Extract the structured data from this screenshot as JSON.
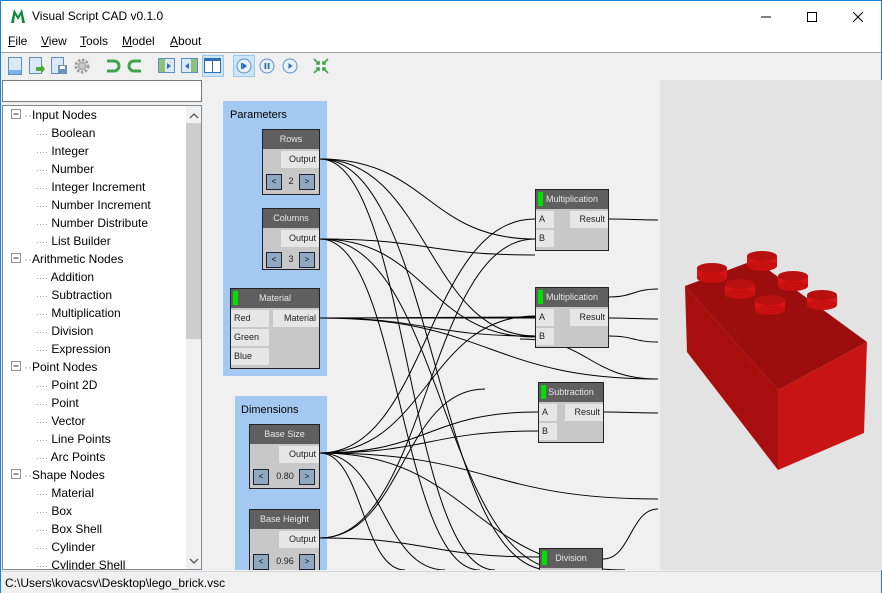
{
  "window": {
    "title": "Visual Script CAD v0.1.0",
    "controls": [
      "minimize",
      "maximize",
      "close"
    ]
  },
  "menu": {
    "items": [
      {
        "label": "File",
        "accel": "F",
        "rest": "ile"
      },
      {
        "label": "View",
        "accel": "V",
        "rest": "iew"
      },
      {
        "label": "Tools",
        "accel": "T",
        "rest": "ools"
      },
      {
        "label": "Model",
        "accel": "M",
        "rest": "odel"
      },
      {
        "label": "About",
        "accel": "A",
        "rest": "bout"
      }
    ]
  },
  "toolbar": {
    "buttons": [
      {
        "icon": "new-file-icon",
        "active": false
      },
      {
        "icon": "open-file-icon",
        "active": false
      },
      {
        "icon": "save-file-icon",
        "active": false
      },
      {
        "icon": "settings-gear-icon",
        "active": false
      },
      {
        "icon": "undo-icon",
        "active": false
      },
      {
        "icon": "redo-icon",
        "active": false
      },
      {
        "icon": "show-left-panel-icon",
        "active": false
      },
      {
        "icon": "show-right-panel-icon",
        "active": false
      },
      {
        "icon": "split-view-icon",
        "active": true
      },
      {
        "icon": "manual-update-icon",
        "active": true
      },
      {
        "icon": "pause-update-icon",
        "active": false
      },
      {
        "icon": "auto-update-icon",
        "active": false
      },
      {
        "icon": "fit-to-view-icon",
        "active": false
      }
    ]
  },
  "search": {
    "value": "",
    "placeholder": ""
  },
  "tree": {
    "categories": [
      {
        "label": "Input Nodes",
        "expanded": true,
        "items": [
          "Boolean",
          "Integer",
          "Number",
          "Integer Increment",
          "Number Increment",
          "Number Distribute",
          "List Builder"
        ]
      },
      {
        "label": "Arithmetic Nodes",
        "expanded": true,
        "items": [
          "Addition",
          "Subtraction",
          "Multiplication",
          "Division",
          "Expression"
        ]
      },
      {
        "label": "Point Nodes",
        "expanded": true,
        "items": [
          "Point 2D",
          "Point",
          "Vector",
          "Line Points",
          "Arc Points"
        ]
      },
      {
        "label": "Shape Nodes",
        "expanded": true,
        "items": [
          "Material",
          "Box",
          "Box Shell",
          "Cylinder",
          "Cylinder Shell"
        ]
      }
    ]
  },
  "graph": {
    "groups": [
      {
        "title": "Parameters"
      },
      {
        "title": "Dimensions"
      }
    ],
    "nodes": {
      "rows": {
        "title": "Rows",
        "output": "Output",
        "value": "2",
        "prev": "<",
        "next": ">"
      },
      "columns": {
        "title": "Columns",
        "output": "Output",
        "value": "3",
        "prev": "<",
        "next": ">"
      },
      "material": {
        "title": "Material",
        "inputs": [
          "Red",
          "Green",
          "Blue"
        ],
        "output": "Material"
      },
      "base_size": {
        "title": "Base Size",
        "output": "Output",
        "value": "0.80",
        "prev": "<",
        "next": ">"
      },
      "base_height": {
        "title": "Base Height",
        "output": "Output",
        "value": "0.96",
        "prev": "<",
        "next": ">"
      },
      "mult1": {
        "title": "Multiplication",
        "inputs": [
          "A",
          "B"
        ],
        "output": "Result"
      },
      "mult2": {
        "title": "Multiplication",
        "inputs": [
          "A",
          "B"
        ],
        "output": "Result"
      },
      "subtraction": {
        "title": "Subtraction",
        "inputs": [
          "A",
          "B"
        ],
        "output": "Result"
      },
      "division": {
        "title": "Division"
      }
    },
    "accent_color": "#00e000"
  },
  "viewport": {
    "model": "lego-brick-2x3",
    "model_color": "#cc1111"
  },
  "status": {
    "path": "C:\\Users\\kovacsv\\Desktop\\lego_brick.vsc"
  }
}
